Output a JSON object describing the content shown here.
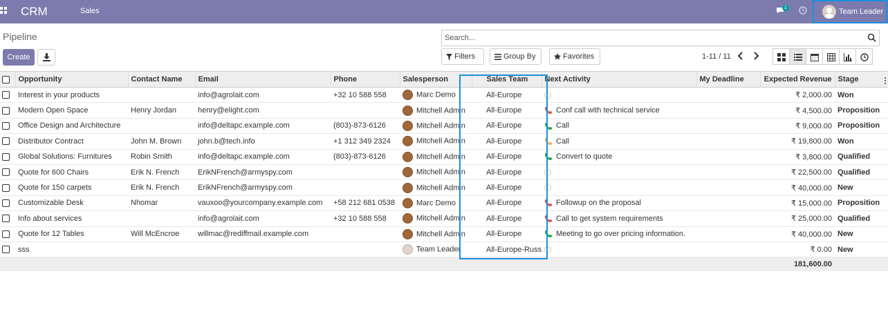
{
  "topbar": {
    "app_name": "CRM",
    "menu_sales": "Sales",
    "chat_badge": "1",
    "user_name": "Team Leader",
    "bg_color": "#7c7bad"
  },
  "control": {
    "breadcrumb": "Pipeline",
    "search_placeholder": "Search...",
    "create_label": "Create",
    "filters_label": "Filters",
    "groupby_label": "Group By",
    "favorites_label": "Favorites",
    "pager": "1-11 / 11"
  },
  "table": {
    "headers": {
      "opportunity": "Opportunity",
      "contact": "Contact Name",
      "email": "Email",
      "phone": "Phone",
      "salesperson": "Salesperson",
      "team": "Sales Team",
      "activity": "Next Activity",
      "deadline": "My Deadline",
      "revenue": "Expected Revenue",
      "stage": "Stage"
    },
    "rows": [
      {
        "opportunity": "Interest in your products",
        "contact": "",
        "email": "info@agrolait.com",
        "phone": "+32 10 588 558",
        "salesperson": "Marc Demo",
        "team": "All-Europe",
        "activity": "",
        "activity_color": "",
        "deadline": "",
        "revenue": "₹ 2,000.00",
        "stage": "Won"
      },
      {
        "opportunity": "Modern Open Space",
        "contact": "Henry Jordan",
        "email": "henry@elight.com",
        "phone": "",
        "salesperson": "Mitchell Admin",
        "team": "All-Europe",
        "activity": "Conf call with technical service",
        "activity_color": "#d9534f",
        "deadline": "",
        "revenue": "₹ 4,500.00",
        "stage": "Proposition"
      },
      {
        "opportunity": "Office Design and Architecture",
        "contact": "",
        "email": "info@deltapc.example.com",
        "phone": "(803)-873-6126",
        "salesperson": "Mitchell Admin",
        "team": "All-Europe",
        "activity": "Call",
        "activity_color": "#28a745",
        "deadline": "",
        "revenue": "₹ 9,000.00",
        "stage": "Proposition"
      },
      {
        "opportunity": "Distributor Contract",
        "contact": "John M. Brown",
        "email": "john.b@tech.info",
        "phone": "+1 312 349 2324",
        "salesperson": "Mitchell Admin",
        "team": "All-Europe",
        "activity": "Call",
        "activity_color": "#f0ad4e",
        "deadline": "",
        "revenue": "₹ 19,800.00",
        "stage": "Won"
      },
      {
        "opportunity": "Global Solutions: Furnitures",
        "contact": "Robin Smith",
        "email": "info@deltapc.example.com",
        "phone": "(803)-873-6126",
        "salesperson": "Mitchell Admin",
        "team": "All-Europe",
        "activity": "Convert to quote",
        "activity_color": "#28a745",
        "deadline": "",
        "revenue": "₹ 3,800.00",
        "stage": "Qualified"
      },
      {
        "opportunity": "Quote for 600 Chairs",
        "contact": "Erik N. French",
        "email": "ErikNFrench@armyspy.com",
        "phone": "",
        "salesperson": "Mitchell Admin",
        "team": "All-Europe",
        "activity": "",
        "activity_color": "",
        "deadline": "",
        "revenue": "₹ 22,500.00",
        "stage": "Qualified"
      },
      {
        "opportunity": "Quote for 150 carpets",
        "contact": "Erik N. French",
        "email": "ErikNFrench@armyspy.com",
        "phone": "",
        "salesperson": "Mitchell Admin",
        "team": "All-Europe",
        "activity": "",
        "activity_color": "",
        "deadline": "",
        "revenue": "₹ 40,000.00",
        "stage": "New"
      },
      {
        "opportunity": "Customizable Desk",
        "contact": "Nhomar",
        "email": "vauxoo@yourcompany.example.com",
        "phone": "+58 212 681 0538",
        "salesperson": "Marc Demo",
        "team": "All-Europe",
        "activity": "Followup on the proposal",
        "activity_color": "#d9534f",
        "deadline": "",
        "revenue": "₹ 15,000.00",
        "stage": "Proposition"
      },
      {
        "opportunity": "Info about services",
        "contact": "",
        "email": "info@agrolait.com",
        "phone": "+32 10 588 558",
        "salesperson": "Mitchell Admin",
        "team": "All-Europe",
        "activity": "Call to get system requirements",
        "activity_color": "#d9534f",
        "deadline": "",
        "revenue": "₹ 25,000.00",
        "stage": "Qualified"
      },
      {
        "opportunity": "Quote for 12 Tables",
        "contact": "Will McEncroe",
        "email": "willmac@rediffmail.example.com",
        "phone": "",
        "salesperson": "Mitchell Admin",
        "team": "All-Europe",
        "activity": "Meeting to go over pricing information.",
        "activity_color": "#28a745",
        "deadline": "",
        "revenue": "₹ 40,000.00",
        "stage": "New"
      },
      {
        "opportunity": "sss",
        "contact": "",
        "email": "",
        "phone": "",
        "salesperson": "Team Leader",
        "team": "All-Europe-Russia",
        "activity": "",
        "activity_color": "",
        "deadline": "",
        "revenue": "₹ 0.00",
        "stage": "New"
      }
    ],
    "total_revenue": "181,600.00"
  }
}
